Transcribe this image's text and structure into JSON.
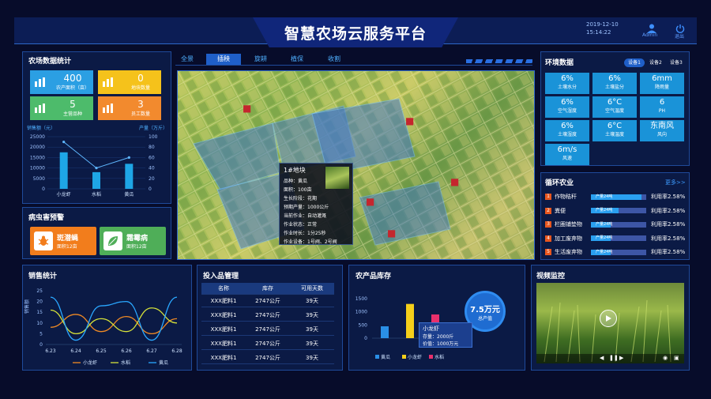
{
  "header": {
    "title": "智慧农场云服务平台",
    "date": "2019-12-10",
    "time": "15:14:22",
    "user": "Admin",
    "logout": "退出"
  },
  "farm_stats": {
    "title": "农场数据统计",
    "cards": [
      {
        "value": "400",
        "label": "农产面积（亩）",
        "color": "#2b9fe3",
        "icon": "area-chart-icon"
      },
      {
        "value": "0",
        "label": "地块数量",
        "color": "#f5c21b",
        "icon": "plots-icon"
      },
      {
        "value": "5",
        "label": "主营品种",
        "color": "#4dbb6b",
        "icon": "variety-icon"
      },
      {
        "value": "3",
        "label": "员工数量",
        "color": "#f28a2e",
        "icon": "staff-icon"
      }
    ],
    "chart_data": {
      "type": "bar",
      "categories": [
        "小龙虾",
        "水稻",
        "黄瓜"
      ],
      "values": [
        17500,
        8000,
        12000
      ],
      "line_values": [
        90,
        40,
        60
      ],
      "ylabel": "销售额（元）",
      "y2label": "产量（万斤）",
      "ylim": [
        0,
        25000
      ],
      "y2lim": [
        0,
        100
      ],
      "yticks": [
        "25000",
        "20000",
        "15000",
        "10000",
        "5000",
        "0"
      ],
      "y2ticks": [
        "100",
        "80",
        "60",
        "40",
        "20",
        "0"
      ]
    }
  },
  "pest": {
    "title": "病虫害预警",
    "items": [
      {
        "name": "斑潜蝇",
        "area": "面积12亩",
        "color": "#f27d1c"
      },
      {
        "name": "霜霉病",
        "area": "面积12亩",
        "color": "#4fae58"
      }
    ]
  },
  "tabs": [
    "全景",
    "插秧",
    "旋耕",
    "植保",
    "收割"
  ],
  "active_tab": "插秧",
  "map_popup": {
    "title": "1#地块",
    "rows": [
      "品种：黄瓜",
      "面积：100亩",
      "生长阶段：花期",
      "预期产量：1000公斤",
      "当前作业：自动灌溉",
      "作业状态：正常",
      "作业时长：1分25秒",
      "作业设备：1号阀、2号阀"
    ]
  },
  "env": {
    "title": "环境数据",
    "devices": [
      "设备1",
      "设备2",
      "设备3"
    ],
    "cells": [
      {
        "v": "6%",
        "l": "土壤水分"
      },
      {
        "v": "6%",
        "l": "土壤盐分"
      },
      {
        "v": "6mm",
        "l": "降雨量"
      },
      {
        "v": "6%",
        "l": "空气湿度"
      },
      {
        "v": "6°C",
        "l": "空气温度"
      },
      {
        "v": "6",
        "l": "PH"
      },
      {
        "v": "6%",
        "l": "土壤湿度"
      },
      {
        "v": "6°C",
        "l": "土壤温度"
      },
      {
        "v": "东南风",
        "l": "风向"
      },
      {
        "v": "6m/s",
        "l": "风速"
      }
    ]
  },
  "cycle": {
    "title": "循环农业",
    "more": "更多>>",
    "items": [
      {
        "idx": "1",
        "name": "作物秸秆",
        "bar_label": "产量24吨",
        "rate": "利用率2.58%",
        "fill": 0.92
      },
      {
        "idx": "2",
        "name": "粪便",
        "bar_label": "产量24吨",
        "rate": "利用率2.58%",
        "fill": 0.5
      },
      {
        "idx": "3",
        "name": "栏圈铺垫物",
        "bar_label": "产量24吨",
        "rate": "利用率2.58%",
        "fill": 0.35
      },
      {
        "idx": "4",
        "name": "加工废弃物",
        "bar_label": "产量24吨",
        "rate": "利用率2.58%",
        "fill": 0.35
      },
      {
        "idx": "5",
        "name": "生活废弃物",
        "bar_label": "产量24吨",
        "rate": "利用率2.58%",
        "fill": 0.35
      }
    ]
  },
  "sales": {
    "title": "销售统计",
    "chart_data": {
      "type": "line",
      "x": [
        "6.23",
        "6.24",
        "6.25",
        "6.26",
        "6.27",
        "6.28"
      ],
      "ylabel": "销售额",
      "ylim": [
        0,
        25
      ],
      "yticks": [
        "25",
        "20",
        "15",
        "10",
        "5",
        "0"
      ],
      "series": [
        {
          "name": "小龙虾",
          "color": "#f08a24",
          "values": [
            8,
            14,
            6,
            13,
            5,
            12
          ]
        },
        {
          "name": "水稻",
          "color": "#d6e23a",
          "values": [
            16,
            5,
            12,
            6,
            17,
            10
          ]
        },
        {
          "name": "黄瓜",
          "color": "#2aa7ff",
          "values": [
            22,
            2,
            18,
            20,
            2,
            22
          ]
        }
      ]
    }
  },
  "inputs": {
    "title": "投入品管理",
    "headers": [
      "名称",
      "库存",
      "可用天数"
    ],
    "rows": [
      [
        "XXX肥料1",
        "2747公斤",
        "39天"
      ],
      [
        "XXX肥料1",
        "2747公斤",
        "39天"
      ],
      [
        "XXX肥料1",
        "2747公斤",
        "39天"
      ],
      [
        "XXX肥料1",
        "2747公斤",
        "39天"
      ],
      [
        "XXX肥料1",
        "2747公斤",
        "39天"
      ]
    ]
  },
  "stock": {
    "title": "农产品库存",
    "total_value": "7.5万元",
    "total_label": "总产值",
    "tooltip": {
      "name": "小龙虾",
      "stock": "存量：2000斤",
      "price": "价值：1000万元"
    },
    "chart_data": {
      "type": "bar",
      "categories": [
        "黄瓜",
        "小龙虾",
        "水稻"
      ],
      "values": [
        450,
        1300,
        900
      ],
      "colors": [
        "#2a8fe6",
        "#f5cf1a",
        "#e8306c"
      ],
      "ylim": [
        0,
        1500
      ],
      "yticks": [
        "1500",
        "1000",
        "500",
        "0"
      ]
    }
  },
  "video": {
    "title": "视频监控"
  }
}
